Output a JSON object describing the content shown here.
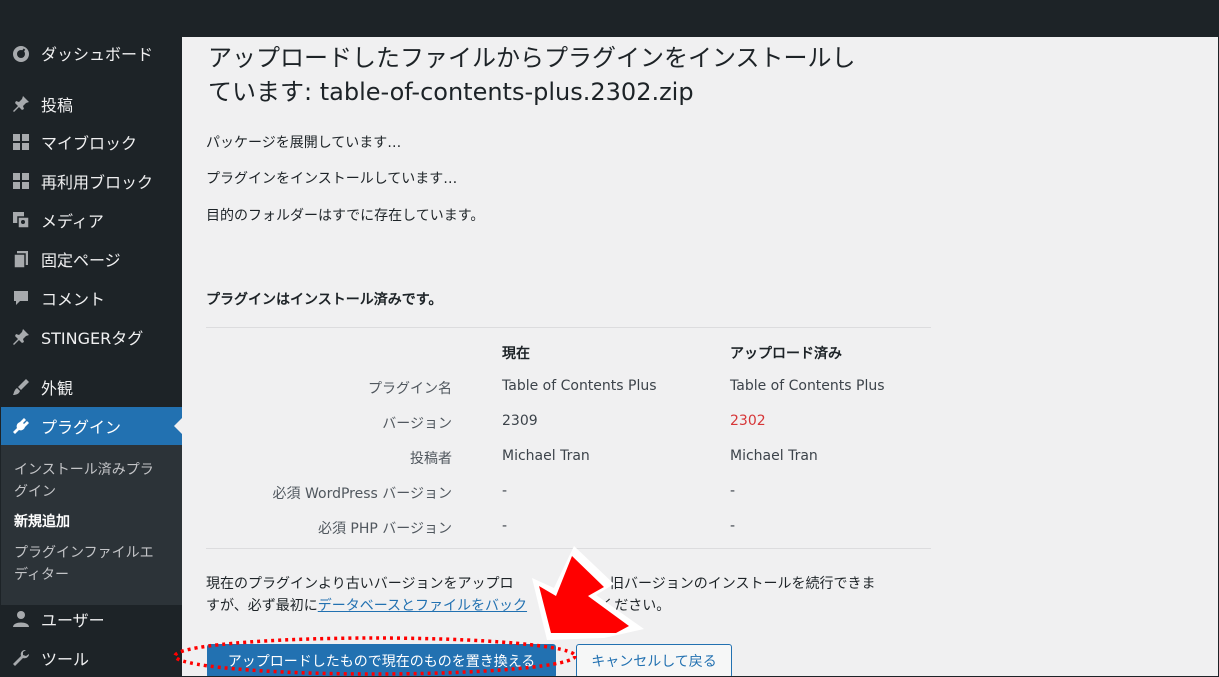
{
  "sidebar": {
    "items": [
      {
        "label": "ダッシュボード",
        "icon": "dashboard-icon"
      },
      {
        "label": "投稿",
        "icon": "pin-icon"
      },
      {
        "label": "マイブロック",
        "icon": "blocks-icon"
      },
      {
        "label": "再利用ブロック",
        "icon": "blocks-icon"
      },
      {
        "label": "メディア",
        "icon": "media-icon"
      },
      {
        "label": "固定ページ",
        "icon": "page-icon"
      },
      {
        "label": "コメント",
        "icon": "comment-icon"
      },
      {
        "label": "STINGERタグ",
        "icon": "pin-icon"
      },
      {
        "label": "外観",
        "icon": "brush-icon"
      },
      {
        "label": "プラグイン",
        "icon": "plugin-icon"
      },
      {
        "label": "ユーザー",
        "icon": "user-icon"
      },
      {
        "label": "ツール",
        "icon": "wrench-icon"
      }
    ],
    "submenu": {
      "installed": "インストール済みプラグイン",
      "installed_line1": "インストール済みプラ",
      "installed_line2": "グイン",
      "add_new": "新規追加",
      "editor_line1": "プラグインファイルエ",
      "editor_line2": "ディター"
    }
  },
  "main": {
    "title_line1": "アップロードしたファイルからプラグインをインストールし",
    "title_line2": "ています: table-of-contents-plus.2302.zip",
    "messages": [
      "パッケージを展開しています…",
      "プラグインをインストールしています…",
      "目的のフォルダーはすでに存在しています。"
    ],
    "status": "プラグインはインストール済みです。",
    "table": {
      "headers": {
        "current": "現在",
        "uploaded": "アップロード済み"
      },
      "rows": [
        {
          "label": "プラグイン名",
          "current": "Table of Contents Plus",
          "uploaded": "Table of Contents Plus"
        },
        {
          "label": "バージョン",
          "current": "2309",
          "uploaded": "2302"
        },
        {
          "label": "投稿者",
          "current": "Michael Tran",
          "uploaded": "Michael Tran"
        },
        {
          "label": "必須 WordPress バージョン",
          "current": "-",
          "uploaded": "-"
        },
        {
          "label": "必須 PHP バージョン",
          "current": "-",
          "uploaded": "-"
        }
      ]
    },
    "notice": {
      "part1": "現在のプラグインより古いバージョンをアップロ",
      "part2": "ます。旧バージョンのインストールを続行できま",
      "part3": "すが、必ず最初に",
      "link": "データベースとファイルをバック",
      "part4": "してください。"
    },
    "buttons": {
      "replace": "アップロードしたもので現在のものを置き換える",
      "cancel": "キャンセルして戻る"
    }
  },
  "colors": {
    "sidebar_bg": "#1d2327",
    "active": "#2271b1",
    "diff": "#d63638",
    "annotation": "#ff0000"
  }
}
